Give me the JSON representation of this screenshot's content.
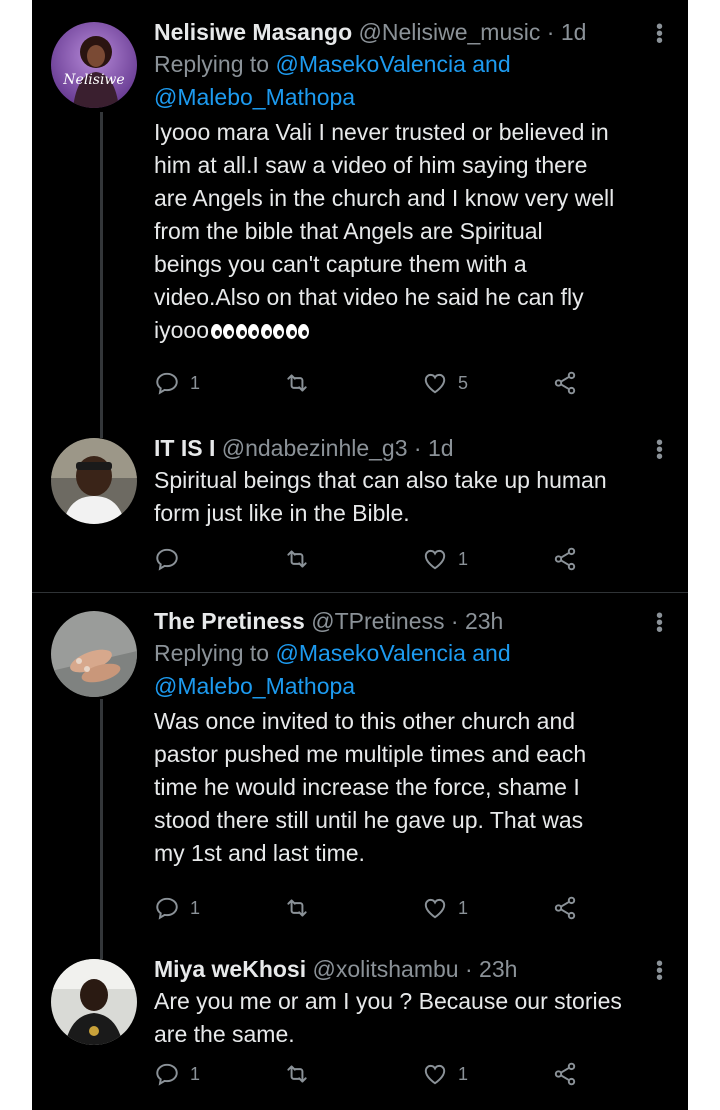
{
  "colors": {
    "background": "#000000",
    "text": "#e7e9ea",
    "muted": "#8b9298",
    "mention": "#1d9bf0",
    "divider": "#2f3336"
  },
  "icons": {
    "reply": "reply-icon",
    "retweet": "retweet-icon",
    "like": "heart-icon",
    "share": "share-icon",
    "more": "more-icon"
  },
  "tweets": [
    {
      "name": "Nelisiwe Masango",
      "handle": "@Nelisiwe_music",
      "dot": "·",
      "time": "1d",
      "avatar_text": "Nelisiwe",
      "replying_prefix": "Replying to",
      "mention1": "@MasekoValencia and",
      "mention2": "@Malebo_Mathopa",
      "text_lines": [
        "Iyooo mara Vali I never trusted or believed in",
        "him at all.I saw a video of him saying there",
        "are Angels in the church and I know very well",
        "from the bible that Angels are Spiritual",
        "beings you can't capture them with a",
        "video.Also on that video he said he can fly",
        "iyooo"
      ],
      "emoji": "👀👀👀👀",
      "reply_count": "1",
      "retweet_count": "",
      "like_count": "5"
    },
    {
      "name": "IT IS I",
      "handle": "@ndabezinhle_g3",
      "dot": "·",
      "time": "1d",
      "text_lines": [
        "Spiritual beings that can also take up human",
        "form just like in the Bible."
      ],
      "reply_count": "",
      "retweet_count": "",
      "like_count": "1"
    },
    {
      "name": "The Pretiness",
      "handle": "@TPretiness",
      "dot": "·",
      "time": "23h",
      "replying_prefix": "Replying to",
      "mention1": "@MasekoValencia and",
      "mention2": "@Malebo_Mathopa",
      "text_lines": [
        "Was once invited to this other church and",
        "pastor pushed me multiple times and each",
        "time he would increase the force, shame I",
        "stood there still until he gave up. That was",
        "my 1st and last time."
      ],
      "reply_count": "1",
      "retweet_count": "",
      "like_count": "1"
    },
    {
      "name": "Miya weKhosi",
      "handle": "@xolitshambu",
      "dot": "·",
      "time": "23h",
      "text_lines": [
        "Are you me or am I you ? Because our stories",
        "are the same."
      ],
      "reply_count": "1",
      "retweet_count": "",
      "like_count": "1"
    }
  ]
}
